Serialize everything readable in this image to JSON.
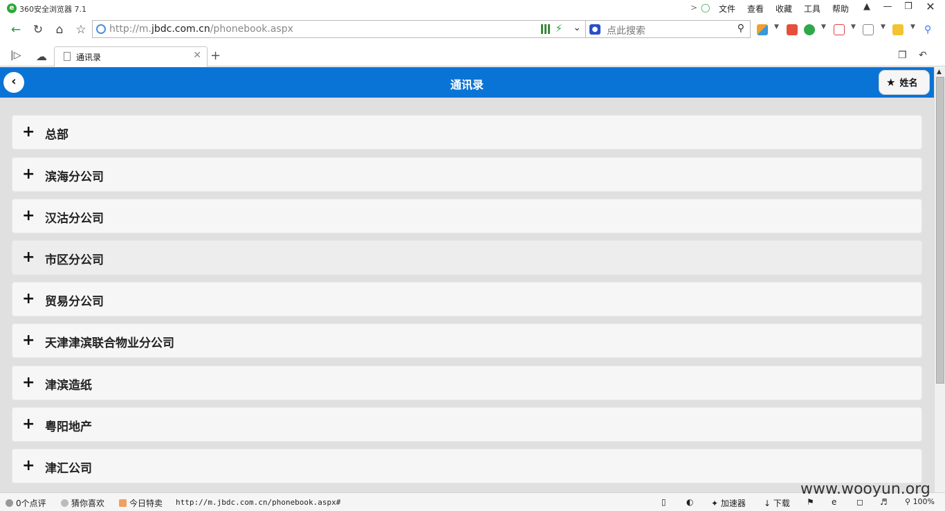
{
  "window": {
    "app_title": "360安全浏览器 7.1",
    "menu": [
      "文件",
      "查看",
      "收藏",
      "工具",
      "帮助"
    ]
  },
  "address_bar": {
    "url_prefix": "http://m.",
    "url_domain": "jbdc.com.cn",
    "url_path": "/phonebook.aspx",
    "search_placeholder": "点此搜索"
  },
  "tabs": [
    {
      "label": "通讯录",
      "active": true
    }
  ],
  "page": {
    "header_title": "通讯录",
    "name_button_label": "姓名",
    "groups": [
      {
        "name": "总部"
      },
      {
        "name": "滨海分公司"
      },
      {
        "name": "汉沽分公司"
      },
      {
        "name": "市区分公司"
      },
      {
        "name": "贸易分公司"
      },
      {
        "name": "天津津滨联合物业分公司"
      },
      {
        "name": "津滨造纸"
      },
      {
        "name": "粤阳地产"
      },
      {
        "name": "津汇公司"
      }
    ]
  },
  "status_bar": {
    "reviews": "0个点评",
    "guess": "猜你喜欢",
    "deals": "今日特卖",
    "status_url": "http://m.jbdc.com.cn/phonebook.aspx#",
    "accelerator": "加速器",
    "download": "下载",
    "zoom": "100%"
  },
  "watermark": "www.wooyun.org",
  "colors": {
    "header_blue": "#0a74d6",
    "page_bg": "#e0e0e0",
    "item_bg": "#f6f6f6"
  }
}
